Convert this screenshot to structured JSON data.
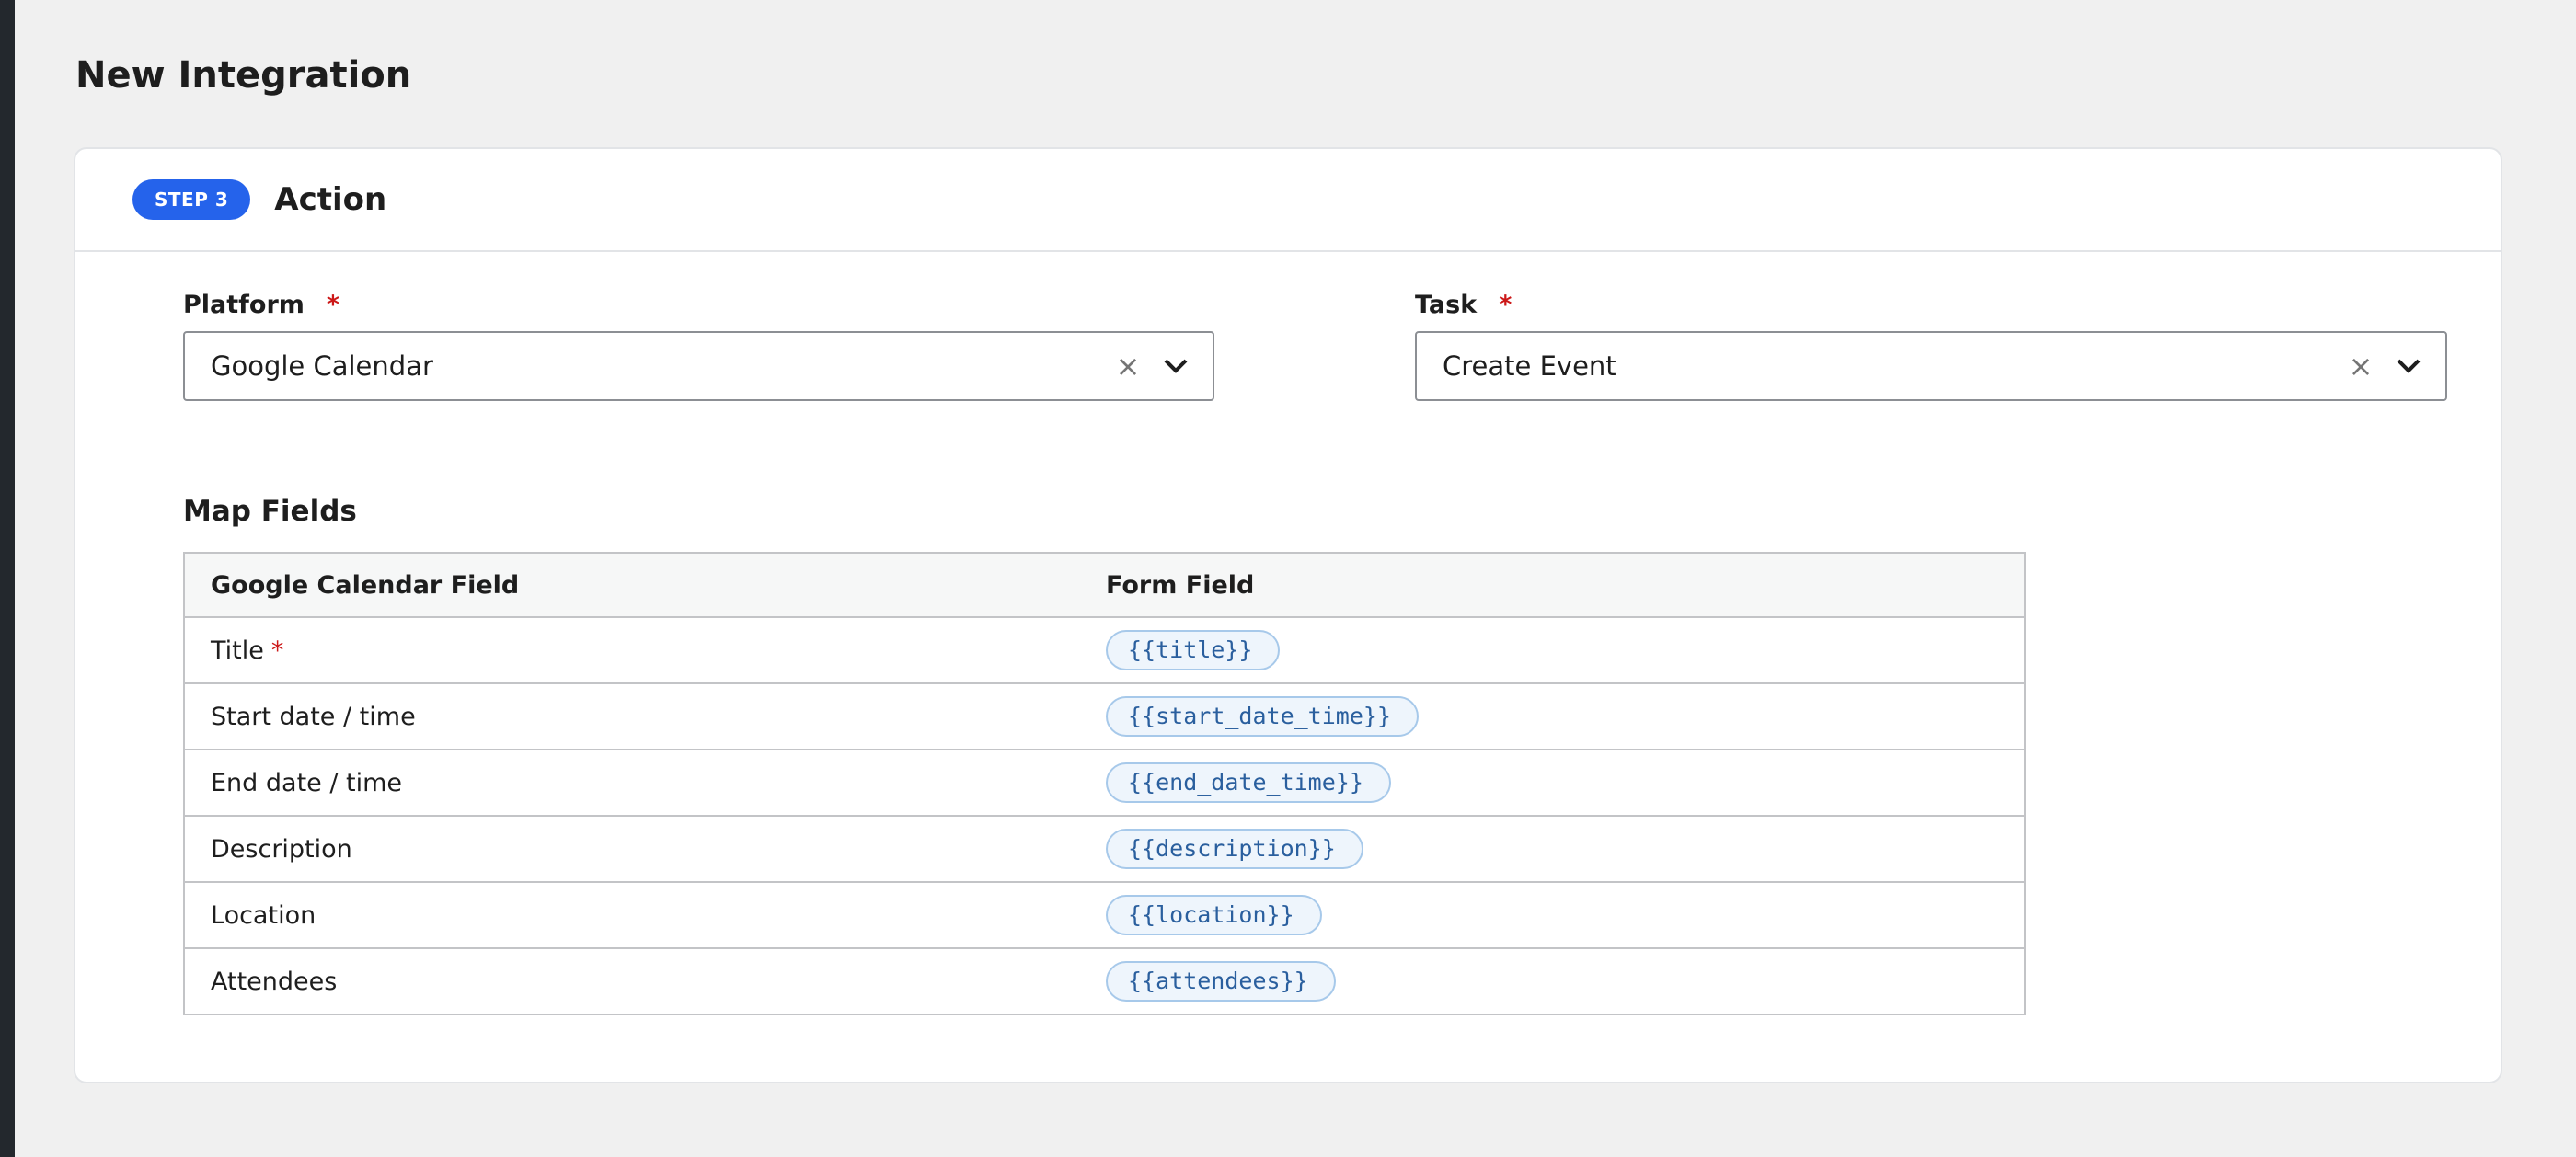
{
  "page": {
    "title": "New Integration"
  },
  "step": {
    "badge": "STEP 3",
    "title": "Action"
  },
  "platform": {
    "label": "Platform",
    "required_mark": "*",
    "value": "Google Calendar"
  },
  "task": {
    "label": "Task",
    "required_mark": "*",
    "value": "Create Event"
  },
  "map_fields": {
    "title": "Map Fields",
    "headers": [
      "Google Calendar Field",
      "Form Field"
    ],
    "rows": [
      {
        "field": "Title",
        "required": "*",
        "token": "{{title}}"
      },
      {
        "field": "Start date / time",
        "token": "{{start_date_time}}"
      },
      {
        "field": "End date / time",
        "token": "{{end_date_time}}"
      },
      {
        "field": "Description",
        "token": "{{description}}"
      },
      {
        "field": "Location",
        "token": "{{location}}"
      },
      {
        "field": "Attendees",
        "token": "{{attendees}}"
      }
    ]
  },
  "icons": {
    "clear": "close-icon",
    "dropdown": "chevron-down-icon"
  },
  "colors": {
    "accent": "#2563eb",
    "required": "#cc1818",
    "token_text": "#2a5f9e",
    "token_bg": "#eef5fc"
  }
}
